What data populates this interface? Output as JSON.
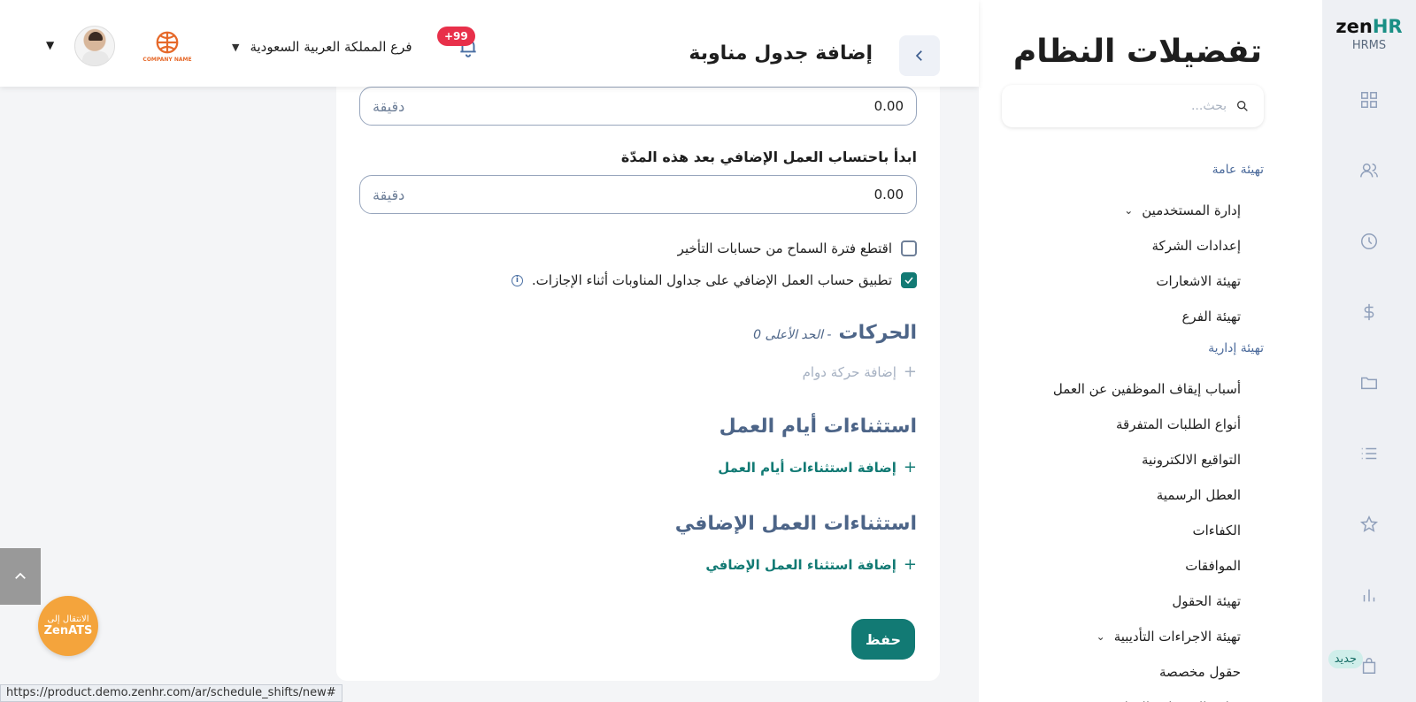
{
  "brand": {
    "logo_main": "zen",
    "logo_accent": "HR",
    "logo_sub": "HRMS",
    "new_badge": "جديد"
  },
  "rail_icons": [
    "dashboard-icon",
    "users-icon",
    "clock-icon",
    "dollar-icon",
    "folder-icon",
    "list-icon",
    "star-icon",
    "chart-icon",
    "bag-icon"
  ],
  "settings": {
    "title": "تفضيلات النظام",
    "search_placeholder": "بحث...",
    "groups": [
      {
        "label": "تهيئة عامة",
        "items": [
          "إدارة المستخدمين",
          "إعدادات الشركة",
          "تهيئة الاشعارات",
          "تهيئة الفرع"
        ]
      },
      {
        "label": "تهيئة إدارية",
        "items": [
          "أسباب إيقاف الموظفين عن العمل",
          "أنواع الطلبات المتفرقة",
          "التواقيع الالكترونية",
          "العطل الرسمية",
          "الكفاءات",
          "الموافقات",
          "تهيئة الحقول",
          "تهيئة الاجراءات التأديبية",
          "حقول مخصصة",
          "نماذج الانضمام والانهاء"
        ]
      }
    ]
  },
  "header": {
    "page_title": "إضافة جدول مناوبة",
    "notif_count": "+99",
    "branch": "فرع المملكة العربية السعودية",
    "company_logo_text": "COMPANY NAME"
  },
  "form": {
    "field1": {
      "value": "0.00",
      "unit": "دقيقة"
    },
    "field2_label": "ابدأ باحتساب العمل الإضافي بعد هذه المدّة",
    "field2": {
      "value": "0.00",
      "unit": "دقيقة"
    },
    "check1": {
      "label": "اقتطع فترة السماح من حسابات التأخير",
      "checked": false
    },
    "check2": {
      "label": "تطبيق حساب العمل الإضافي على جداول المناوبات أثناء الإجازات.",
      "checked": true
    },
    "movements": {
      "title": "الحركات",
      "subtitle": "- الحد الأعلى 0",
      "add_label": "إضافة حركة دوام"
    },
    "workday_exceptions": {
      "title": "استثناءات أيام العمل",
      "add_label": "إضافة استثناءات أيام العمل"
    },
    "overtime_exceptions": {
      "title": "استثناءات العمل الإضافي",
      "add_label": "إضافة استثناء العمل الإضافي"
    },
    "save_label": "حفظ"
  },
  "floating": {
    "ats_line1": "الانتقال إلى",
    "ats_line2": "ZenATS"
  },
  "status_url": "https://product.demo.zenhr.com/ar/schedule_shifts/new#",
  "colors": {
    "accent": "#127a74",
    "section": "#4d6588",
    "badge": "#e8304a",
    "ats": "#f4a43c"
  }
}
